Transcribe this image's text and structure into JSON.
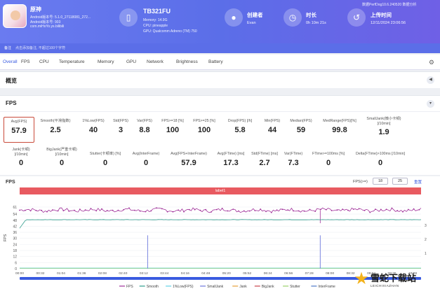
{
  "header": {
    "app": {
      "name": "原神",
      "line1": "Android版本号: 5.1.0_27118081_272...",
      "line2": "Android版本号: 903",
      "line3": "com.miHoYo.ys.bilibili"
    },
    "device": {
      "name": "TB321FU",
      "memory": "Memory: 14.9G",
      "cpu": "CPU: pineapple",
      "gpu": "GPU: Qualcomm Adreno (TM) 750"
    },
    "creator": {
      "title": "创建者",
      "value": "Evan"
    },
    "duration": {
      "title": "时长",
      "value": "0h 10m 21s"
    },
    "upload": {
      "title": "上传时间",
      "value": "12/11/2024 23:06:56",
      "top_note": "数据PerfDog10.6.240520 数据分析"
    }
  },
  "notice": {
    "left": "备注",
    "text": "点击添加备注, 不超过100个字符"
  },
  "tabs": [
    "Overall",
    "FPS",
    "CPU",
    "Temperature",
    "Memory",
    "GPU",
    "Network",
    "Brightness",
    "Battery"
  ],
  "sections": {
    "overview": "概览",
    "fps": "FPS"
  },
  "stats_row1": [
    {
      "label": "Avg(FPS)",
      "value": "57.9"
    },
    {
      "label": "Smooth(平滑指数)",
      "value": "2.5"
    },
    {
      "label": "1%Low(FPS)",
      "value": "40"
    },
    {
      "label": "Std(FPS)",
      "value": "3"
    },
    {
      "label": "Var(FPS)",
      "value": "8.8"
    },
    {
      "label": "FPS>=18 [%]",
      "value": "100"
    },
    {
      "label": "FPS>=25 [%]",
      "value": "100"
    },
    {
      "label": "Drop(FPS) [/h]",
      "value": "5.8"
    },
    {
      "label": "Min(FPS)",
      "value": "44"
    },
    {
      "label": "Median(FPS)",
      "value": "59"
    },
    {
      "label": "MedRange(FPS)[%]",
      "value": "99.8"
    },
    {
      "label": "SmallJank(微小卡顿) [/10min]",
      "value": "1.9"
    }
  ],
  "stats_row2": [
    {
      "label": "Jank(卡顿) [/10min]",
      "value": "0"
    },
    {
      "label": "BigJank(严重卡顿) [/10min]",
      "value": "0"
    },
    {
      "label": "Stutter(卡顿率) [%]",
      "value": "0"
    },
    {
      "label": "Avg(InterFrame)",
      "value": "0"
    },
    {
      "label": "Avg(FPS+InterFrame)",
      "value": "57.9"
    },
    {
      "label": "Avg(FTime) [ms]",
      "value": "17.3"
    },
    {
      "label": "Std(FTime) [ms]",
      "value": "2.7"
    },
    {
      "label": "Var(FTime)",
      "value": "7.3"
    },
    {
      "label": "FTime>=100ms [%]",
      "value": "0"
    },
    {
      "label": "Delta(FTime)>100ms [/10min]",
      "value": "0"
    }
  ],
  "chart_controls": {
    "title": "FPS",
    "fps_label": "FPS(>=)",
    "fps_min": "18",
    "fps_max": "25",
    "reset": "重置",
    "band_label": "label1"
  },
  "chart_data": {
    "type": "line",
    "ylabel": "FPS",
    "ylim": [
      0,
      61
    ],
    "yticks": [
      "61",
      "54",
      "48",
      "42",
      "36",
      "30",
      "24",
      "18",
      "12",
      "6",
      "0"
    ],
    "right_yticks": [
      "3",
      "2",
      "1"
    ],
    "xticks": [
      "00:00",
      "00:32",
      "01:04",
      "01:36",
      "02:08",
      "02:40",
      "03:12",
      "03:44",
      "04:16",
      "04:48",
      "05:20",
      "05:52",
      "06:24",
      "06:56",
      "07:28",
      "08:00",
      "08:32",
      "09:04",
      "09:36",
      "10:08"
    ],
    "x_end_minutes": 10.35,
    "series": [
      {
        "name": "FPS",
        "color": "#a0319a",
        "base": 57.9,
        "noise": 3.2
      },
      {
        "name": "Smooth",
        "color": "#2f9c8c",
        "base": 48.5,
        "noise": 0.3
      },
      {
        "name": "1%Low(FPS)",
        "color": "#60d2e6",
        "base": 0,
        "noise": 0
      },
      {
        "name": "SmallJank",
        "color": "#6d78dd",
        "spikes": [
          3.3,
          7.75
        ]
      },
      {
        "name": "Jank",
        "color": "#e5a13a"
      },
      {
        "name": "BigJank",
        "color": "#c8434b"
      },
      {
        "name": "Stutter",
        "color": "#9ad06a"
      },
      {
        "name": "InterFrame",
        "color": "#4c78c8"
      }
    ]
  },
  "watermark": {
    "text": "雪蛇下载站",
    "sub": "LEICHIXIAZHAN"
  }
}
